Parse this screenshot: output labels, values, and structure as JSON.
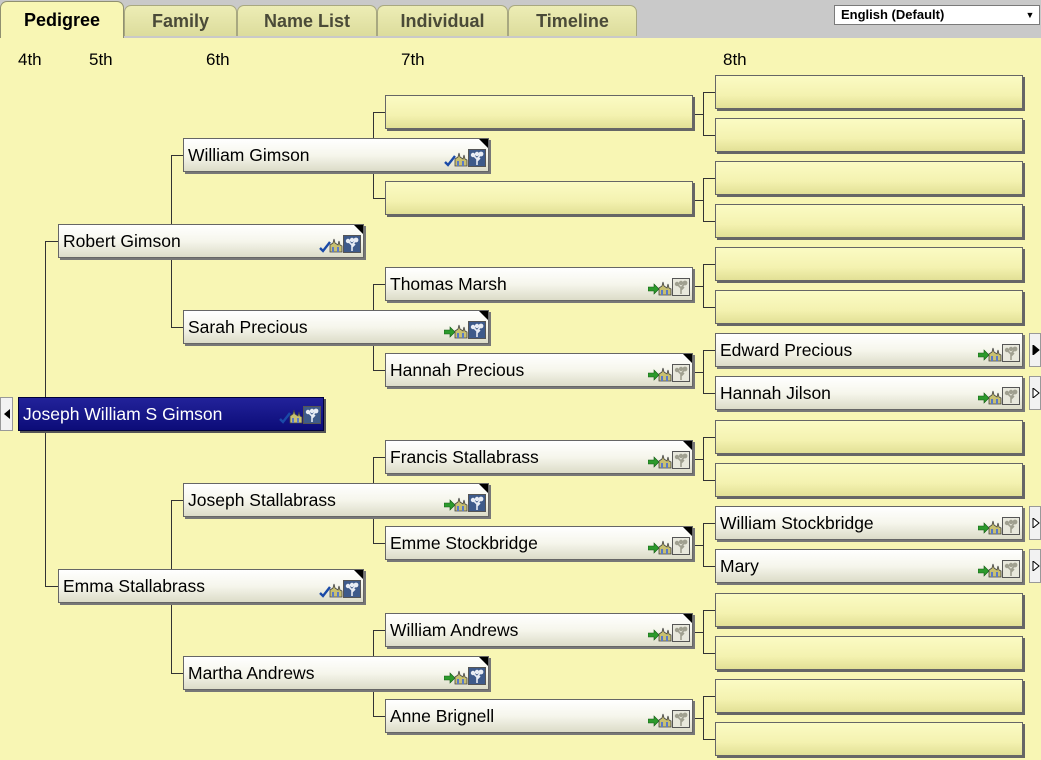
{
  "tabs": [
    {
      "label": "Pedigree",
      "active": true
    },
    {
      "label": "Family",
      "active": false
    },
    {
      "label": "Name List",
      "active": false
    },
    {
      "label": "Individual",
      "active": false
    },
    {
      "label": "Timeline",
      "active": false
    }
  ],
  "language_select": {
    "value": "English (Default)"
  },
  "generations": [
    "4th",
    "5th",
    "6th",
    "7th",
    "8th"
  ],
  "colors": {
    "background": "#f8f6b4",
    "selected_box": "#14148a",
    "empty_box": "#f4f2b0",
    "tab_bar": "#c9c9c9"
  },
  "root": {
    "name": "Joseph William S Gimson"
  },
  "gen5": [
    {
      "name": "Robert Gimson"
    },
    {
      "name": "Emma Stallabrass"
    }
  ],
  "gen6": [
    {
      "name": "William Gimson"
    },
    {
      "name": "Sarah Precious"
    },
    {
      "name": "Joseph Stallabrass"
    },
    {
      "name": "Martha Andrews"
    }
  ],
  "gen7": [
    {
      "name": ""
    },
    {
      "name": ""
    },
    {
      "name": "Thomas Marsh"
    },
    {
      "name": "Hannah Precious"
    },
    {
      "name": "Francis Stallabrass"
    },
    {
      "name": "Emme Stockbridge"
    },
    {
      "name": "William Andrews"
    },
    {
      "name": "Anne Brignell"
    }
  ],
  "gen8": [
    {
      "name": ""
    },
    {
      "name": ""
    },
    {
      "name": ""
    },
    {
      "name": ""
    },
    {
      "name": ""
    },
    {
      "name": ""
    },
    {
      "name": "Edward Precious"
    },
    {
      "name": "Hannah Jilson"
    },
    {
      "name": ""
    },
    {
      "name": ""
    },
    {
      "name": "William Stockbridge"
    },
    {
      "name": "Mary"
    },
    {
      "name": ""
    },
    {
      "name": ""
    },
    {
      "name": ""
    },
    {
      "name": ""
    }
  ]
}
